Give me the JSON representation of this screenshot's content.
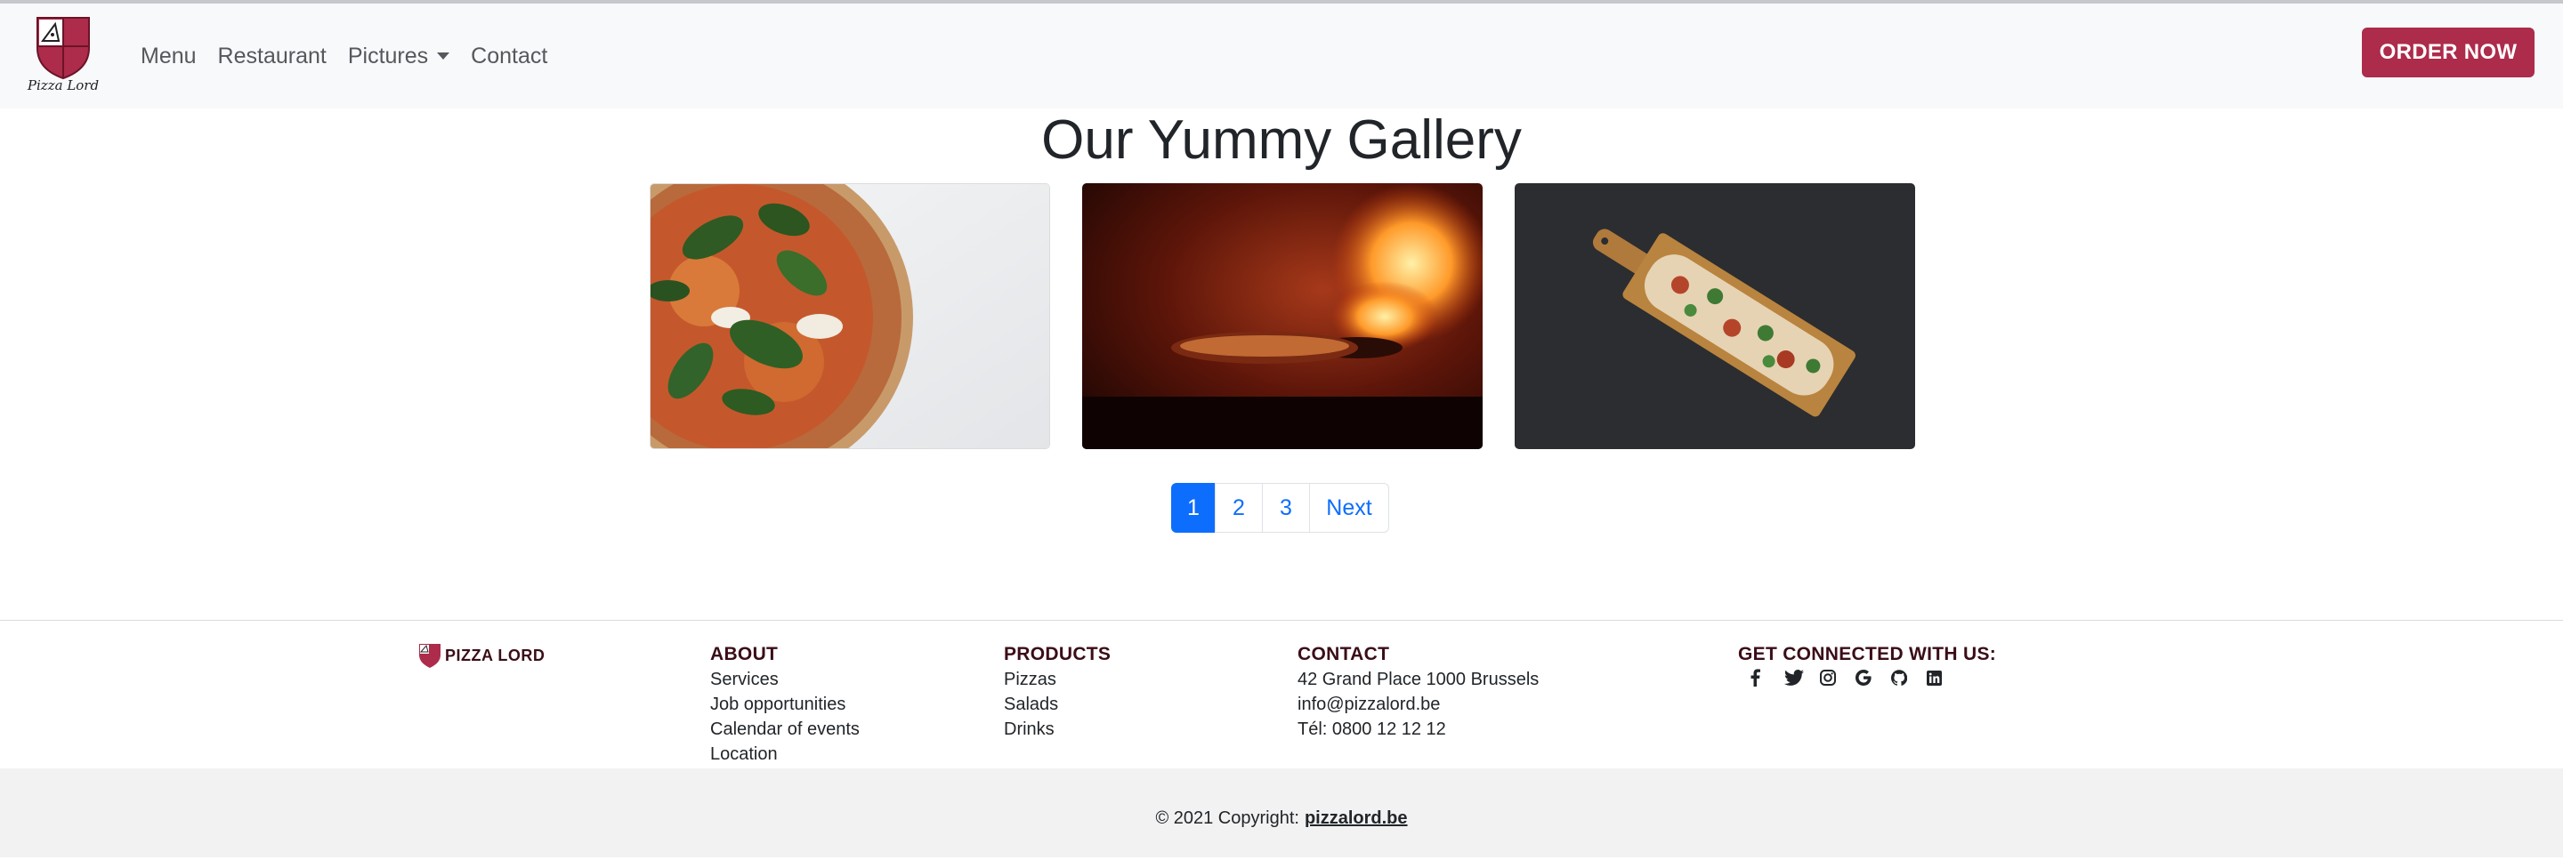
{
  "brand": {
    "logo_text": "Pizza Lord",
    "name": "PIZZA LORD"
  },
  "nav": {
    "items": [
      {
        "label": "Menu"
      },
      {
        "label": "Restaurant"
      },
      {
        "label": "Pictures"
      },
      {
        "label": "Contact"
      }
    ],
    "order_button": "ORDER NOW"
  },
  "gallery": {
    "title": "Our Yummy Gallery",
    "photos": [
      {
        "alt": "pizza with basil"
      },
      {
        "alt": "pizza in wood-fired oven"
      },
      {
        "alt": "flatbread on wooden board"
      }
    ]
  },
  "pagination": {
    "pages": [
      "1",
      "2",
      "3"
    ],
    "next": "Next",
    "active": "1"
  },
  "footer": {
    "about": {
      "heading": "ABOUT",
      "links": [
        "Services",
        "Job opportunities",
        "Calendar of events",
        "Location"
      ]
    },
    "products": {
      "heading": "PRODUCTS",
      "links": [
        "Pizzas",
        "Salads",
        "Drinks"
      ]
    },
    "contact": {
      "heading": "CONTACT",
      "lines": [
        "42 Grand Place 1000 Brussels",
        "info@pizzalord.be",
        "Tél: 0800 12 12 12"
      ]
    },
    "social": {
      "heading": "GET CONNECTED WITH US:",
      "icons": [
        "facebook-icon",
        "twitter-icon",
        "instagram-icon",
        "google-icon",
        "github-icon",
        "linkedin-icon"
      ]
    },
    "copyright": {
      "text": "© 2021 Copyright:",
      "link": "pizzalord.be"
    }
  },
  "colors": {
    "accent": "#ad2b4b",
    "dark_brand": "#3b0d17",
    "link_blue": "#0d6efd"
  }
}
